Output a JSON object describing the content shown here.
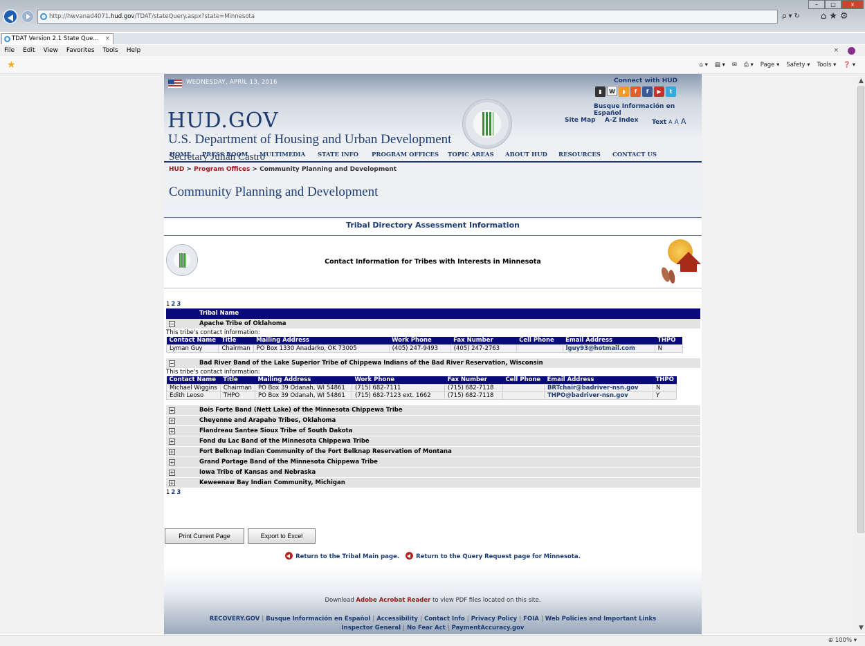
{
  "browser": {
    "url_prefix": "http://hwvanad4071.",
    "url_domain": "hud.gov",
    "url_suffix": "/TDAT/stateQuery.aspx?state=Minnesota",
    "search_glyph": "ρ ▾ ↻",
    "tab_title": "TDAT Version 2.1 State Que...",
    "tab_close": "×",
    "menu": [
      "File",
      "Edit",
      "View",
      "Favorites",
      "Tools",
      "Help"
    ],
    "menu_close": "×",
    "commands": [
      "⌂ ▾",
      "▤ ▾",
      "✉",
      "⎙ ▾",
      "Page ▾",
      "Safety ▾",
      "Tools ▾",
      "❓ ▾"
    ],
    "zoom": "⊕ 100%  ▾",
    "window_controls": {
      "min": "–",
      "max": "□",
      "close": "x"
    }
  },
  "header": {
    "date": "WEDNESDAY, APRIL 13, 2016",
    "site_name": "HUD.GOV",
    "department": "U.S. Department of Housing and Urban Development",
    "secretary": "Secretary Julián Castro",
    "connect": "Connect with HUD",
    "social": [
      "▮",
      "W",
      "◗",
      "f",
      "f",
      "▶",
      "t"
    ],
    "busque": "Busque Información en Español",
    "site_map": "Site Map",
    "az_index": "A-Z Index",
    "text_label": "Text",
    "text_sizes": [
      "A",
      "A",
      "A"
    ]
  },
  "nav": [
    "HOME",
    "PRESS ROOM",
    "MULTIMEDIA",
    "STATE INFO",
    "PROGRAM OFFICES",
    "TOPIC AREAS",
    "ABOUT HUD",
    "RESOURCES",
    "CONTACT US"
  ],
  "breadcrumb": {
    "hud": "HUD",
    "sep": ">",
    "program_offices": "Program Offices",
    "current": "Community Planning and Development"
  },
  "page_title": "Community Planning and Development",
  "section_title": "Tribal Directory Assessment Information",
  "contact_heading": "Contact Information for Tribes with Interests in Minnesota",
  "pager": {
    "current": "1",
    "pages": [
      "2",
      "3"
    ]
  },
  "grid": {
    "header": "Tribal Name",
    "contact_label": "This tribe's contact information:",
    "columns": [
      "Contact Name",
      "Title",
      "Mailing Address",
      "Work Phone",
      "Fax Number",
      "Cell Phone",
      "Email Address",
      "THPO"
    ],
    "expanded": [
      {
        "name": "Apache Tribe of Oklahoma",
        "toggle": "−",
        "contacts": [
          [
            "Lyman Guy",
            "Chairman",
            "PO Box 1330 Anadarko, OK 73005",
            "(405) 247-9493",
            "(405) 247-2763",
            "",
            "lguy93@hotmail.com",
            "N"
          ]
        ]
      },
      {
        "name": "Bad River Band of the Lake Superior Tribe of Chippewa Indians of the Bad River Reservation, Wisconsin",
        "toggle": "−",
        "contacts": [
          [
            "Michael Wiggins",
            "Chairman",
            "PO Box 39 Odanah, WI 54861",
            "(715) 682-7111",
            "(715) 682-7118",
            "",
            "BRTchair@badriver-nsn.gov",
            "N"
          ],
          [
            "Edith Leoso",
            "THPO",
            "PO Box 39 Odanah, WI 54861",
            "(715) 682-7123 ext. 1662",
            "(715) 682-7118",
            "",
            "THPO@badriver-nsn.gov",
            "Y"
          ]
        ]
      }
    ],
    "collapsed": [
      "Bois Forte Band (Nett Lake) of the Minnesota Chippewa Tribe",
      "Cheyenne and Arapaho Tribes, Oklahoma",
      "Flandreau Santee Sioux Tribe of South Dakota",
      "Fond du Lac Band of the Minnesota Chippewa Tribe",
      "Fort Belknap Indian Community of the Fort Belknap Reservation of Montana",
      "Grand Portage Band of the Minnesota Chippewa Tribe",
      "Iowa Tribe of Kansas and Nebraska",
      "Keweenaw Bay Indian Community, Michigan"
    ],
    "collapsed_toggle": "+"
  },
  "buttons": {
    "print": "Print Current Page",
    "export": "Export to Excel"
  },
  "return_links": {
    "tribal_main": "Return to the Tribal Main page.",
    "query_request": "Return to the Query Request page for Minnesota."
  },
  "footer": {
    "acrobat_pre": "Download ",
    "acrobat_link": "Adobe Acrobat Reader",
    "acrobat_post": " to view PDF files located on this site.",
    "links_row1": [
      "RECOVERY.GOV",
      "Busque Información en Español",
      "Accessibility",
      "Contact Info",
      "Privacy Policy",
      "FOIA",
      "Web Policies and Important Links"
    ],
    "links_row2": [
      "Inspector General",
      "No Fear Act",
      "PaymentAccuracy.gov"
    ],
    "sep": "|"
  }
}
